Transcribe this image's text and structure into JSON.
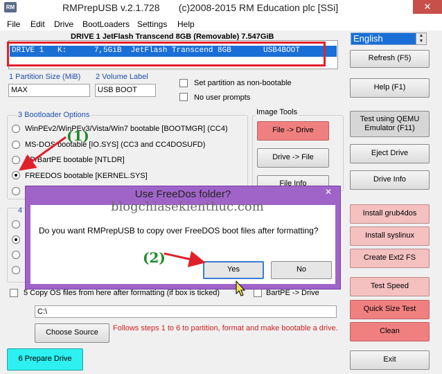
{
  "window": {
    "icon_text": "RM",
    "title": "RMPrepUSB v.2.1.728       (c)2008-2015 RM Education plc [SSi]",
    "close_glyph": "✕"
  },
  "menu": [
    "File",
    "Edit",
    "Drive",
    "BootLoaders",
    "Settings",
    "Help"
  ],
  "drive_header": "DRIVE 1 JetFlash Transcend 8GB (Removable) 7.547GiB",
  "drive_row": "DRIVE 1   K:      7,5GiB  JetFlash Transcend 8GB       USB4BOOT",
  "language": {
    "value": "English"
  },
  "partition": {
    "label": "1 Partition Size (MiB)",
    "value": "MAX"
  },
  "volume": {
    "label": "2 Volume Label",
    "value": "USB BOOT"
  },
  "options": {
    "non_bootable": "Set partition as non-bootable",
    "no_prompts": "No user prompts"
  },
  "bootloader": {
    "title": "3 Bootloader Options",
    "items": [
      "WinPEv2/WinPEv3/Vista/Win7 bootable [BOOTMGR] (CC4)",
      "MS-DOS bootable [IO.SYS]    (CC3 and CC4DOSUFD)",
      "XP/BartPE bootable [NTLDR]",
      "FREEDOS bootable [KERNEL.SYS]"
    ]
  },
  "section4_label": "4",
  "image_tools": {
    "title": "Image Tools",
    "file_to_drive": "File -> Drive",
    "drive_to_file": "Drive -> File",
    "file_info": "File Info"
  },
  "right_buttons": {
    "refresh": "Refresh (F5)",
    "help": "Help (F1)",
    "test_qemu": "Test using QEMU Emulator (F11)",
    "eject": "Eject Drive",
    "drive_info": "Drive Info",
    "grub4dos": "Install grub4dos",
    "syslinux": "Install syslinux",
    "ext2": "Create Ext2 FS",
    "test_speed": "Test Speed",
    "quick_size": "Quick Size Test",
    "clean": "Clean",
    "exit": "Exit"
  },
  "copy_os": {
    "label": "5 Copy OS files from here after formatting (if box is ticked)",
    "bart": "BartPE -> Drive"
  },
  "source_path": "C:\\",
  "choose_source": "Choose Source",
  "hint": "Follows steps 1 to 6 to partition, format and make bootable a drive.",
  "prepare": "6 Prepare Drive",
  "dialog": {
    "title": "Use FreeDos folder?",
    "message": "Do you want RMPrepUSB to copy over FreeDOS boot files after formatting?",
    "yes": "Yes",
    "no": "No"
  },
  "watermark": "blogchiasekienthuc.com",
  "annotations": {
    "step1": "(1)",
    "step2": "(2)"
  },
  "colors": {
    "selection": "#1a6fd6",
    "highlight_box": "#e0202a",
    "dialog_frame": "#a064c8",
    "prepare": "#2ef0f0"
  }
}
